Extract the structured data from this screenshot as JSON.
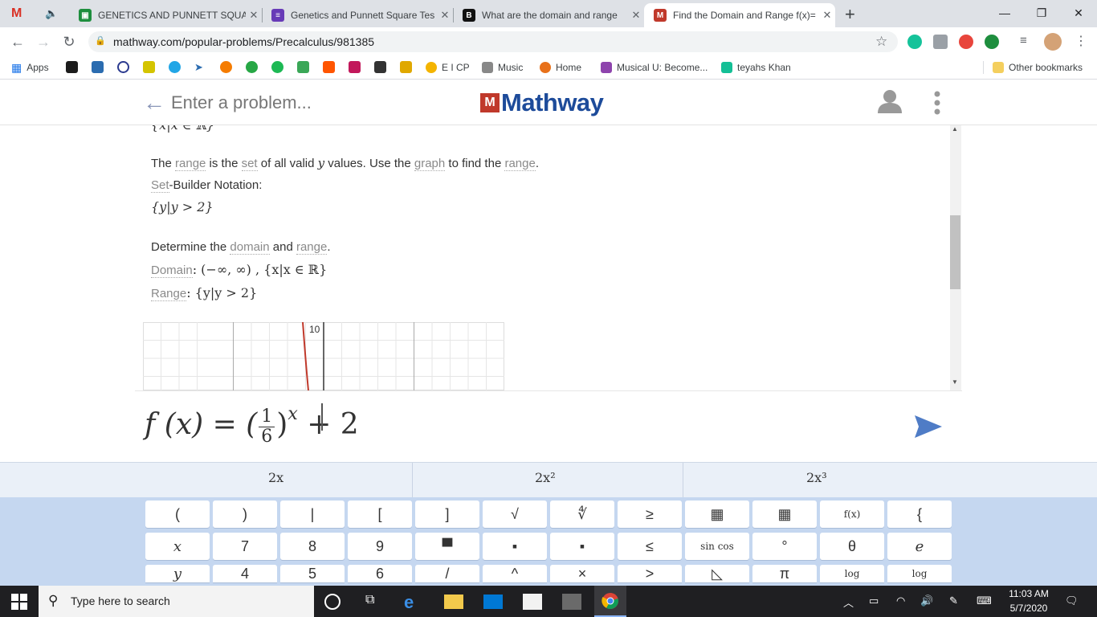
{
  "browser": {
    "tabs": [
      {
        "title": "GENETICS AND PUNNETT SQUAR",
        "icon": "classroom-icon",
        "color": "#1e8e3e"
      },
      {
        "title": "Genetics and Punnett Square Tes",
        "icon": "forms-icon",
        "color": "#673ab7"
      },
      {
        "title": "What are the domain and range",
        "icon": "brainly-icon",
        "color": "#111111"
      },
      {
        "title": "Find the Domain and Range f(x)=",
        "icon": "mathway-icon",
        "color": "#c0392b"
      }
    ],
    "url": "mathway.com/popular-problems/Precalculus/981385",
    "bookmarks": [
      "Apps",
      "E I CP",
      "Music",
      "Home",
      "Musical U: Become...",
      "teyahs Khan",
      "Other bookmarks"
    ]
  },
  "header": {
    "placeholder": "Enter a problem...",
    "logo_mark": "M",
    "logo_text": "Mathway"
  },
  "content": {
    "cut_line": "{x|x ∈ ℝ}",
    "range_p1": "The ",
    "range_l1": "range",
    "range_p2": " is the ",
    "range_l2": "set",
    "range_p3": " of all valid ",
    "range_var": "y",
    "range_p4": " values. Use the ",
    "range_l3": "graph",
    "range_p5": " to find the ",
    "range_l4": "range",
    "range_p6": ".",
    "setb_link": "Set",
    "setb_rest": "-Builder Notation:",
    "range_set": "{y|y > 2}",
    "det_p1": "Determine the ",
    "det_l1": "domain",
    "det_p2": " and ",
    "det_l2": "range",
    "det_p3": ".",
    "domain_label": "Domain",
    "domain_value": ": (−∞, ∞) , {x|x ∈ ℝ}",
    "range_label": "Range",
    "range_value": ": {y|y > 2}",
    "graph_tick": "10"
  },
  "input": {
    "formula_lhs": "f (x) = (",
    "frac_num": "1",
    "frac_den": "6",
    "formula_rhs": ")",
    "exponent": "x",
    "tail": "+ 2"
  },
  "keypad": {
    "suggestions": [
      "2x",
      "2x²",
      "2x³"
    ],
    "row1": [
      "(",
      ")",
      "|",
      "[",
      "]",
      "√",
      "∜",
      "≥",
      "▦",
      "▦",
      "f(x)",
      "{"
    ],
    "row2": [
      "x",
      "7",
      "8",
      "9",
      "▀",
      "▪",
      "▪",
      "≤",
      "sin cos",
      "°",
      "θ",
      "e"
    ],
    "row3": [
      "y",
      "4",
      "5",
      "6",
      "/",
      "^",
      "×",
      ">",
      "◺",
      "π",
      "log",
      "log"
    ]
  },
  "taskbar": {
    "search_placeholder": "Type here to search",
    "time": "11:03 AM",
    "date": "5/7/2020"
  },
  "colors": {
    "accent": "#1d4b9a",
    "send": "#4f7cc6",
    "keypad_bg": "#c5d7f0"
  }
}
